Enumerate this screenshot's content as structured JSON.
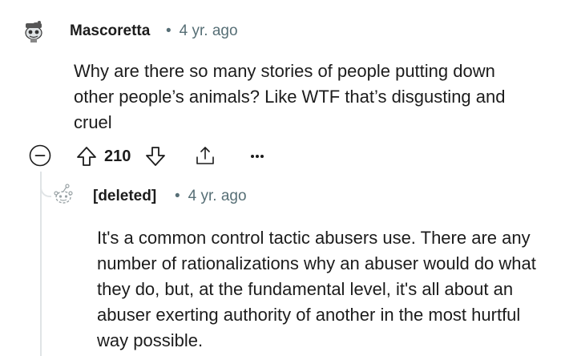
{
  "comment": {
    "author": "Mascoretta",
    "separator": "•",
    "time": "4 yr. ago",
    "body": "Why are there so many stories of people putting down other people’s animals? Like WTF that’s disgusting and cruel",
    "score": "210",
    "icons": {
      "avatar": "snoo-avatar-icon",
      "collapse": "collapse-minus-icon",
      "upvote": "upvote-arrow-icon",
      "downvote": "downvote-arrow-icon",
      "share": "share-icon",
      "more": "more-options-icon"
    }
  },
  "reply": {
    "author": "[deleted]",
    "separator": "•",
    "time": "4 yr. ago",
    "body": "It's a common control tactic abusers use. There are any number of rationalizations why an abuser would do what they do, but, at the fundamental level, it's all about an abuser exerting authority of another in the most hurtful way possible.",
    "icons": {
      "avatar": "deleted-snoo-avatar-icon"
    }
  },
  "colors": {
    "text": "#1c1c1c",
    "meta": "#576f76",
    "thread_line": "#e0e4e6"
  }
}
